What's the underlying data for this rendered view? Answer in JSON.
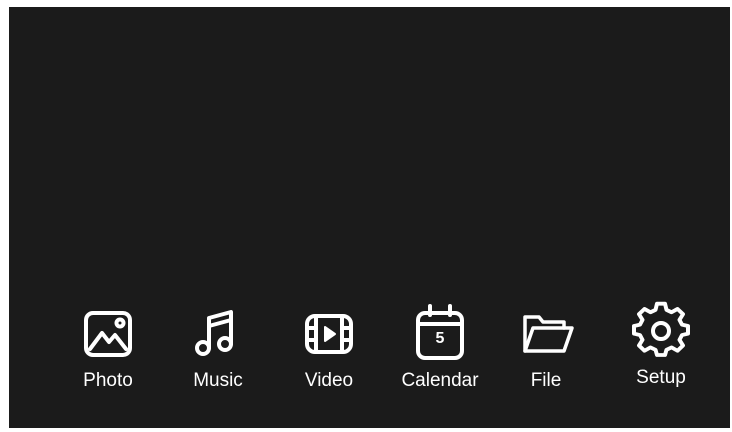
{
  "menu": {
    "items": [
      {
        "label": "Photo",
        "icon": "photo-icon"
      },
      {
        "label": "Music",
        "icon": "music-note-icon"
      },
      {
        "label": "Video",
        "icon": "video-film-icon"
      },
      {
        "label": "Calendar",
        "icon": "calendar-icon",
        "calendar_day": "5"
      },
      {
        "label": "File",
        "icon": "folder-icon"
      },
      {
        "label": "Setup",
        "icon": "gear-icon"
      }
    ]
  },
  "colors": {
    "background": "#1b1b1b",
    "foreground": "#ffffff"
  }
}
